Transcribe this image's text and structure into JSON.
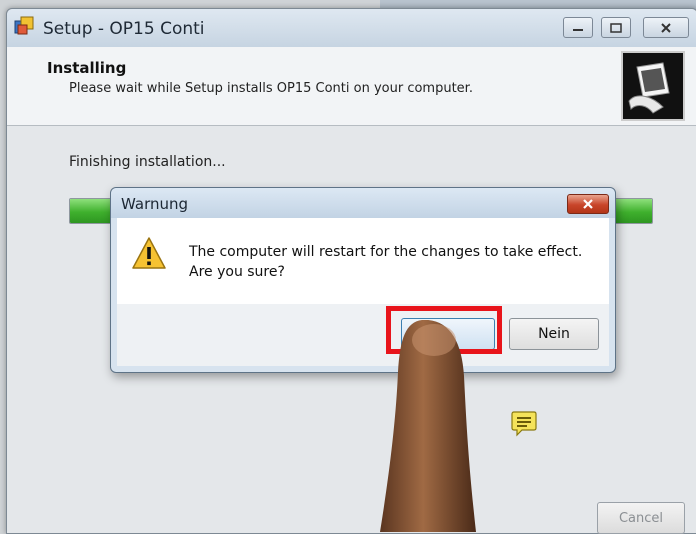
{
  "window": {
    "title": "Setup - OP15 Conti"
  },
  "header": {
    "title": "Installing",
    "subtitle": "Please wait while Setup installs OP15 Conti on your computer."
  },
  "content": {
    "status": "Finishing installation...",
    "progress": 1.0,
    "cancel_label": "Cancel"
  },
  "dialog": {
    "title": "Warnung",
    "message_line1": "The computer will restart for the changes to take effect.",
    "message_line2": "Are you sure?",
    "yes_label": "",
    "no_label": "Nein"
  },
  "icons": {
    "app": "installer-icon",
    "logo": "computer-logo-icon",
    "warning": "warning-triangle-icon",
    "close": "close-icon",
    "note": "note-icon"
  },
  "colors": {
    "highlight": "#e8141b",
    "progress": "#3fb02d",
    "dialog_close": "#c8452a"
  }
}
